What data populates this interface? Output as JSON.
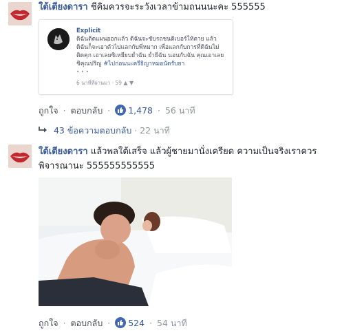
{
  "comments": [
    {
      "author": "ใต้เตียงดารา",
      "text": "ชีคิมควรจะระวังเวลาข้ามถนนนะคะ 555555",
      "embed": {
        "name": "Explicit",
        "text": "ดิฉันติดแผนออกแล้ว ดิฉันจะซับรถชนดิเบอร์ให้ตาย แล้วดิฉันก็จะเอาตัวไปแลกกับพี่หมาก เพื่อแลกกับการที่ดิฉันไม่ติดคุก เอาเลยซิเหยียบย่ำฉัน ย่ำยีฉัน นอนกับฉัน คุณเอาเลยชิคุณปริญ",
        "hashtag": "#ไปก่อนนะครีธิญาหมอนัดรับยา",
        "more": "• • •",
        "time": "6 นาทีที่ผ่านมา",
        "likes": "59"
      },
      "actions": {
        "like": "ถูกใจ",
        "reply": "ตอบกลับ",
        "like_count": "1,478",
        "time": "56 นาที"
      },
      "replies": {
        "label": "43 ข้อความตอบกลับ",
        "time": "22 นาที"
      }
    },
    {
      "author": "ใต้เตียงดารา",
      "text_line1": "แล้วพลใต้เสร็จ แล้วผู้ชายมานั่งเครียด ความเป็นจริงเราควร",
      "text_line2": "พิจารณานะ 555555555555",
      "actions": {
        "like": "ถูกใจ",
        "reply": "ตอบกลับ",
        "like_count": "524",
        "time": "54 นาที"
      }
    }
  ],
  "colors": {
    "link": "#365899",
    "meta": "#90949c",
    "like_badge": "#4267b2"
  }
}
